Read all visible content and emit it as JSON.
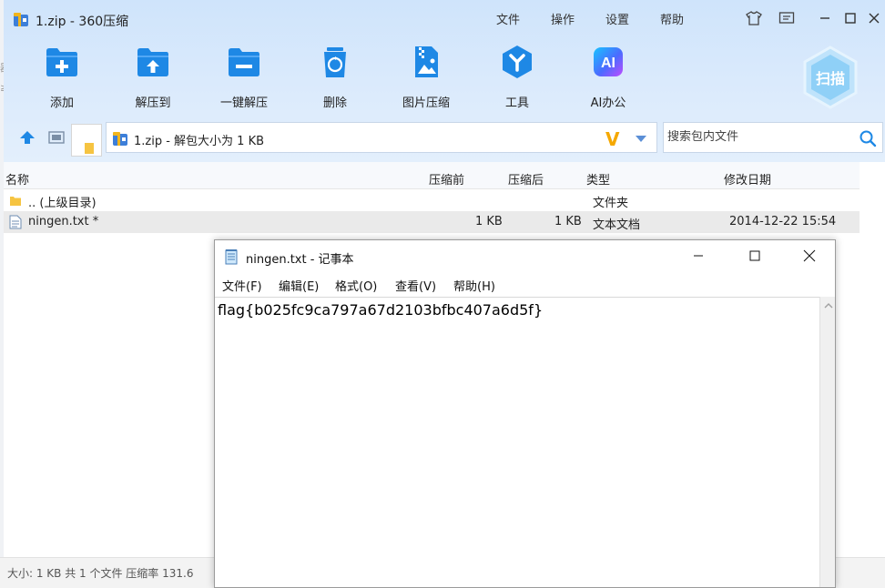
{
  "zip_window": {
    "title": "1.zip - 360压缩",
    "menu": [
      "文件",
      "操作",
      "设置",
      "帮助"
    ],
    "toolbar": [
      {
        "label": "添加",
        "icon": "add-folder-icon"
      },
      {
        "label": "解压到",
        "icon": "extract-to-icon"
      },
      {
        "label": "一键解压",
        "icon": "one-click-extract-icon"
      },
      {
        "label": "删除",
        "icon": "recycle-delete-icon"
      },
      {
        "label": "图片压缩",
        "icon": "image-compress-icon"
      },
      {
        "label": "工具",
        "icon": "tools-icon"
      },
      {
        "label": "AI办公",
        "icon": "ai-office-icon"
      }
    ],
    "scan_label": "扫描",
    "address": "1.zip - 解包大小为 1 KB",
    "brand_letter": "V",
    "search_placeholder": "搜索包内文件",
    "columns": [
      "名称",
      "压缩前",
      "压缩后",
      "类型",
      "修改日期"
    ],
    "rows": [
      {
        "name": ".. (上级目录)",
        "before": "",
        "after": "",
        "type": "文件夹",
        "date": "",
        "icon": "folder-icon"
      },
      {
        "name": "ningen.txt *",
        "before": "1 KB",
        "after": "1 KB",
        "type": "文本文档",
        "date": "2014-12-22 15:54",
        "icon": "text-file-icon"
      }
    ],
    "status": "大小: 1 KB 共 1 个文件 压缩率 131.6",
    "colors": {
      "accent": "#1e88e5",
      "header_bg": "#d8e8fb",
      "brand": "#f5a800"
    }
  },
  "notepad": {
    "title": "ningen.txt - 记事本",
    "menu": [
      "文件(F)",
      "编辑(E)",
      "格式(O)",
      "查看(V)",
      "帮助(H)"
    ],
    "content": "flag{b025fc9ca797a67d2103bfbc407a6d5f}"
  }
}
